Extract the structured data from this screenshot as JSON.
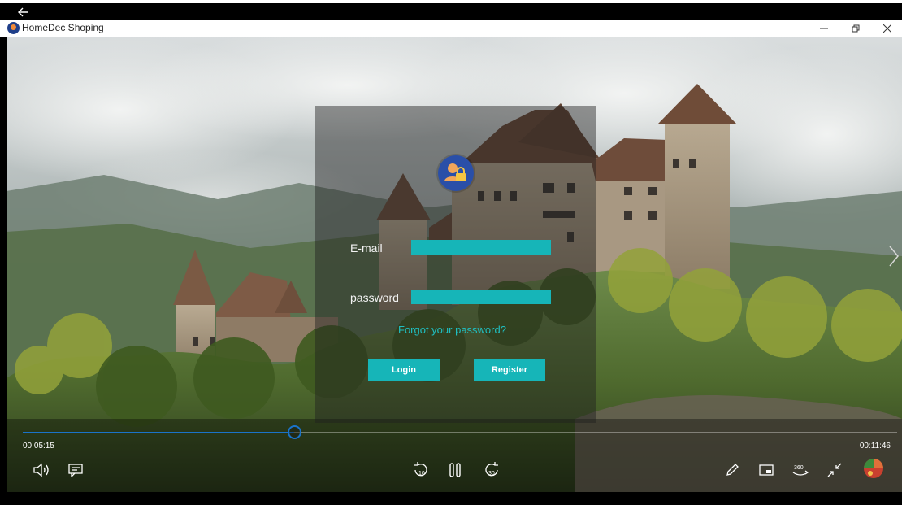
{
  "app": {
    "title": "HomeDec Shoping"
  },
  "login": {
    "email_label": "E-mail",
    "email_value": "",
    "password_label": "password",
    "password_value": "",
    "forgot_link": "Forgot your password?",
    "login_button": "Login",
    "register_button": "Register"
  },
  "player": {
    "current_time": "00:05:15",
    "total_time": "00:11:46",
    "progress_fraction": 0.31,
    "skip_back_seconds": "10",
    "skip_forward_seconds": "30",
    "view_360_label": "360"
  },
  "colors": {
    "accent_teal": "#16b5b8",
    "seek_blue": "#1a73c9"
  }
}
